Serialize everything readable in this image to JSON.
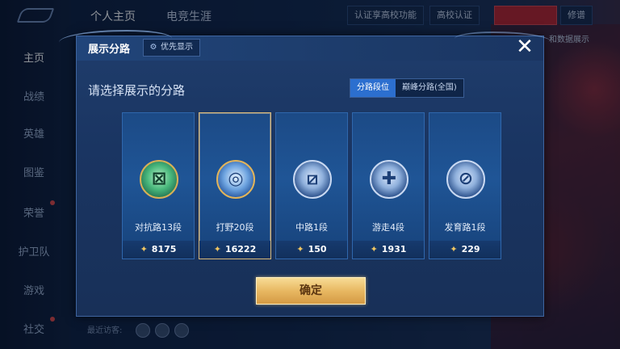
{
  "background": {
    "top_tabs": [
      "个人主页",
      "电竞生涯"
    ],
    "top_buttons": {
      "verify": "认证享高校功能",
      "campus": "高校认证",
      "right": "修谱"
    },
    "behind_text": "和数据展示",
    "sidebar": [
      "主页",
      "战绩",
      "英雄",
      "图鉴",
      "荣誉",
      "护卫队",
      "游戏",
      "社交"
    ],
    "visitors_label": "最近访客:"
  },
  "modal": {
    "title": "展示分路",
    "pref_button": "优先显示",
    "close_icon": "✕",
    "subtitle": "请选择展示的分路",
    "toggle": [
      "分路段位",
      "巅峰分路(全国)"
    ],
    "toggle_selected": 0,
    "cards": [
      {
        "label": "对抗路13段",
        "score": "8175",
        "icon": "clash-lane-icon",
        "selected": false
      },
      {
        "label": "打野20段",
        "score": "16222",
        "icon": "jungle-icon",
        "selected": true
      },
      {
        "label": "中路1段",
        "score": "150",
        "icon": "mid-lane-icon",
        "selected": false
      },
      {
        "label": "游走4段",
        "score": "1931",
        "icon": "roam-icon",
        "selected": false
      },
      {
        "label": "发育路1段",
        "score": "229",
        "icon": "farm-lane-icon",
        "selected": false
      }
    ],
    "confirm": "确定"
  },
  "colors": {
    "accent": "#2c6fcf",
    "gold": "#e8b862",
    "panel": "#1a3562"
  }
}
